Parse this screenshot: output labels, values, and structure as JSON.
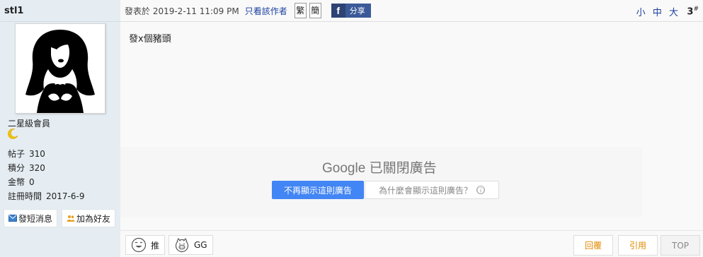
{
  "user": {
    "name": "stl1",
    "rank": "二星級會員",
    "stats": [
      {
        "label": "帖子",
        "value": "310"
      },
      {
        "label": "積分",
        "value": "320"
      },
      {
        "label": "金幣",
        "value": "0"
      },
      {
        "label": "註冊時間",
        "value": "2017-6-9"
      }
    ],
    "send_pm": "發短消息",
    "add_friend": "加為好友"
  },
  "post": {
    "meta": "發表於 2019-2-11 11:09 PM",
    "only_author": "只看該作者",
    "trad": "繁",
    "simp": "簡",
    "fb_share": "分享",
    "font_small": "小",
    "font_medium": "中",
    "font_large": "大",
    "floor": "3",
    "floor_mark": "#",
    "content": "發x個豬頭"
  },
  "ad": {
    "google": "Google",
    "closed_text": "已關閉廣告",
    "stop_label": "不再顯示這則廣告",
    "why_label": "為什麼會顯示這則廣告？",
    "info_icon": "ⓘ"
  },
  "actions": {
    "push": "推",
    "gg": "GG",
    "reply": "回覆",
    "quote": "引用",
    "top": "TOP"
  }
}
